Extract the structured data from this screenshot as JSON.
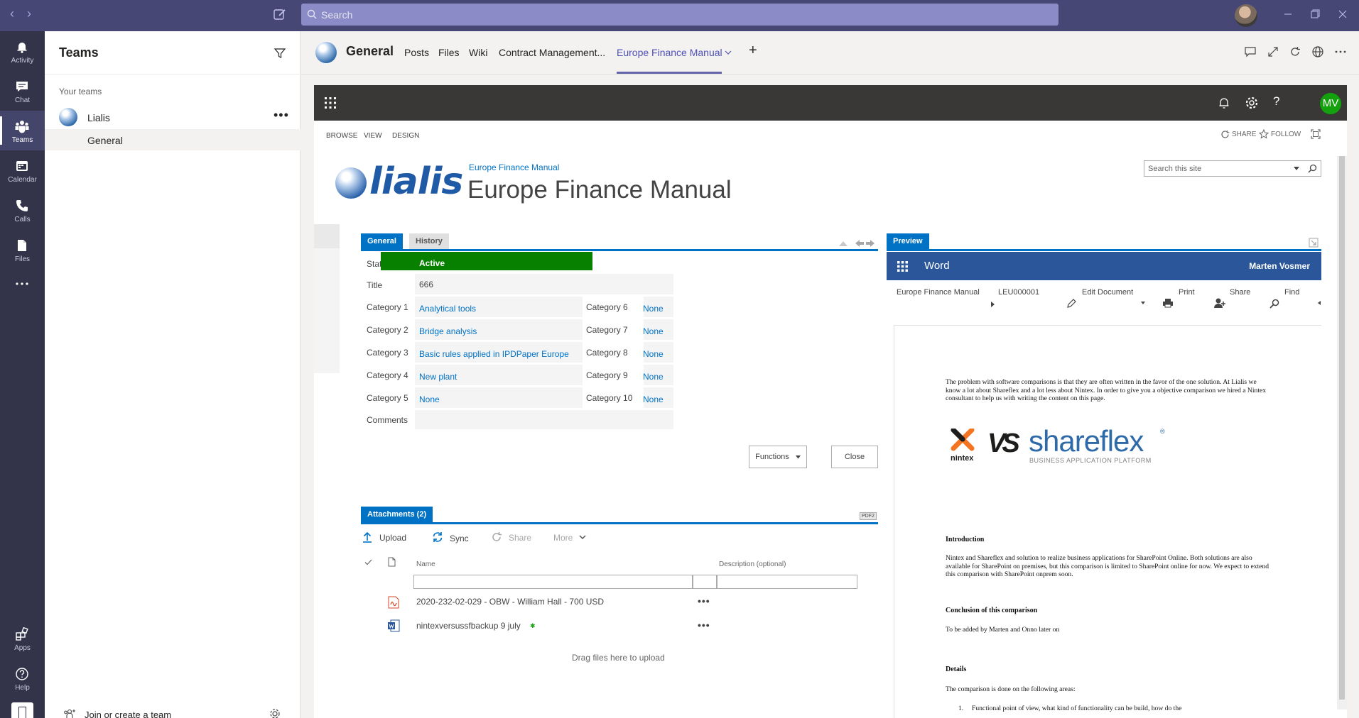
{
  "titlebar": {
    "search_placeholder": "Search"
  },
  "rail": [
    {
      "label": "Activity",
      "icon": "bell-icon"
    },
    {
      "label": "Chat",
      "icon": "chat-icon"
    },
    {
      "label": "Teams",
      "icon": "teams-icon"
    },
    {
      "label": "Calendar",
      "icon": "calendar-icon"
    },
    {
      "label": "Calls",
      "icon": "phone-icon"
    },
    {
      "label": "Files",
      "icon": "file-icon"
    },
    {
      "label": "...",
      "icon": "more-icon"
    },
    {
      "label": "Apps",
      "icon": "apps-icon"
    },
    {
      "label": "Help",
      "icon": "help-icon"
    }
  ],
  "teams_panel": {
    "title": "Teams",
    "section": "Your teams",
    "team_name": "Lialis",
    "team_more": "•••",
    "channel": "General",
    "join": "Join or create a team"
  },
  "channel_header": {
    "name": "General",
    "tabs": [
      "Posts",
      "Files",
      "Wiki",
      "Contract Management...",
      "Europe Finance Manual"
    ],
    "add_tab": "+"
  },
  "sharepoint": {
    "user_initials": "MV",
    "ribbon_tabs": [
      "BROWSE",
      "VIEW",
      "DESIGN"
    ],
    "share": "SHARE",
    "follow": "FOLLOW",
    "logo_text": "lialis",
    "breadcrumb": "Europe Finance Manual",
    "title": "Europe Finance Manual",
    "search_placeholder": "Search this site"
  },
  "form": {
    "tabs": [
      "General",
      "History"
    ],
    "status_label": "Status",
    "status_value": "Active",
    "title_label": "Title",
    "title_value": "666",
    "categories_left": [
      {
        "label": "Category 1",
        "value": "Analytical tools"
      },
      {
        "label": "Category 2",
        "value": "Bridge analysis"
      },
      {
        "label": "Category 3",
        "value": "Basic rules applied in IPDPaper Europe"
      },
      {
        "label": "Category 4",
        "value": "New plant"
      },
      {
        "label": "Category 5",
        "value": "None"
      }
    ],
    "categories_right": [
      {
        "label": "Category 6",
        "value": "None"
      },
      {
        "label": "Category 7",
        "value": "None"
      },
      {
        "label": "Category 8",
        "value": "None"
      },
      {
        "label": "Category 9",
        "value": "None"
      },
      {
        "label": "Category 10",
        "value": "None"
      }
    ],
    "comments_label": "Comments",
    "functions_button": "Functions",
    "close_button": "Close"
  },
  "attachments": {
    "tab": "Attachments (2)",
    "pdf_badge": "PDF2",
    "actions": {
      "upload": "Upload",
      "sync": "Sync",
      "share": "Share",
      "more": "More"
    },
    "col_name": "Name",
    "col_desc": "Description (optional)",
    "files": [
      {
        "name": "2020-232-02-029 - OBW - William Hall - 700 USD",
        "type": "pdf"
      },
      {
        "name": "nintexversussfbackup 9 july",
        "type": "word"
      }
    ],
    "row_more": "•••",
    "drop_hint": "Drag files here to upload"
  },
  "preview": {
    "tab": "Preview",
    "app": "Word",
    "user": "Marten Vosmer",
    "crumb_root": "Europe Finance Manual",
    "crumb_doc": "LEU000001",
    "tools": [
      "Edit Document",
      "Print",
      "Share",
      "Find"
    ],
    "doc": {
      "intro_para": "The problem with software comparisons is that they are often written in the favor of the one solution. At Lialis we know a lot about Shareflex and a lot less about Nintex. In order to give you a objective comparison we hired a Nintex consultant to help us with writing the content on this page.",
      "logo_nintex": "nintex",
      "logo_vs": "VS",
      "logo_shareflex": "shareflex",
      "logo_tagline": "BUSINESS APPLICATION PLATFORM",
      "h_intro": "Introduction",
      "p_intro": "Nintex and Shareflex and solution to realize business applications for SharePoint Online. Both solutions are also available for SharePoint on premises, but this comparison is limited to SharePoint online for now. We expect to extend this comparison with SharePoint onprem soon.",
      "h_conclusion": "Conclusion of this comparison",
      "p_conclusion": "To be added by Marten and Onno later on",
      "h_details": "Details",
      "p_details": "The comparison is done on the following areas:",
      "li_1": "Functional point of view, what kind of functionality can be build, how do the"
    }
  }
}
